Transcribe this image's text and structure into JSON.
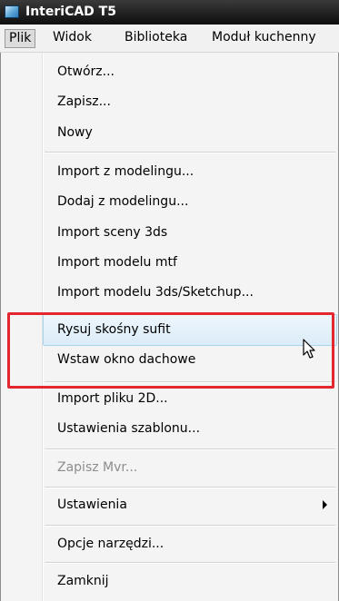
{
  "window": {
    "title": "InteriCAD T5"
  },
  "menubar": {
    "items": [
      "Plik",
      "Widok",
      "Biblioteka",
      "Moduł kuchenny"
    ]
  },
  "file_menu": {
    "open": "Otwórz...",
    "save": "Zapisz...",
    "new": "Nowy",
    "import_modeling": "Import z modelingu...",
    "add_modeling": "Dodaj z modelingu...",
    "import_3ds": "Import sceny 3ds",
    "import_mtf": "Import modelu mtf",
    "import_sketchup": "Import modelu 3ds/Sketchup...",
    "draw_slanted_ceiling": "Rysuj skośny sufit",
    "insert_roof_window": "Wstaw okno dachowe",
    "import_2d": "Import pliku 2D...",
    "template_settings": "Ustawienia szablonu...",
    "save_mvr": "Zapisz Mvr...",
    "settings": "Ustawienia",
    "tool_options": "Opcje narzędzi...",
    "close": "Zamknij"
  },
  "highlight": {
    "color": "#e4262e"
  }
}
